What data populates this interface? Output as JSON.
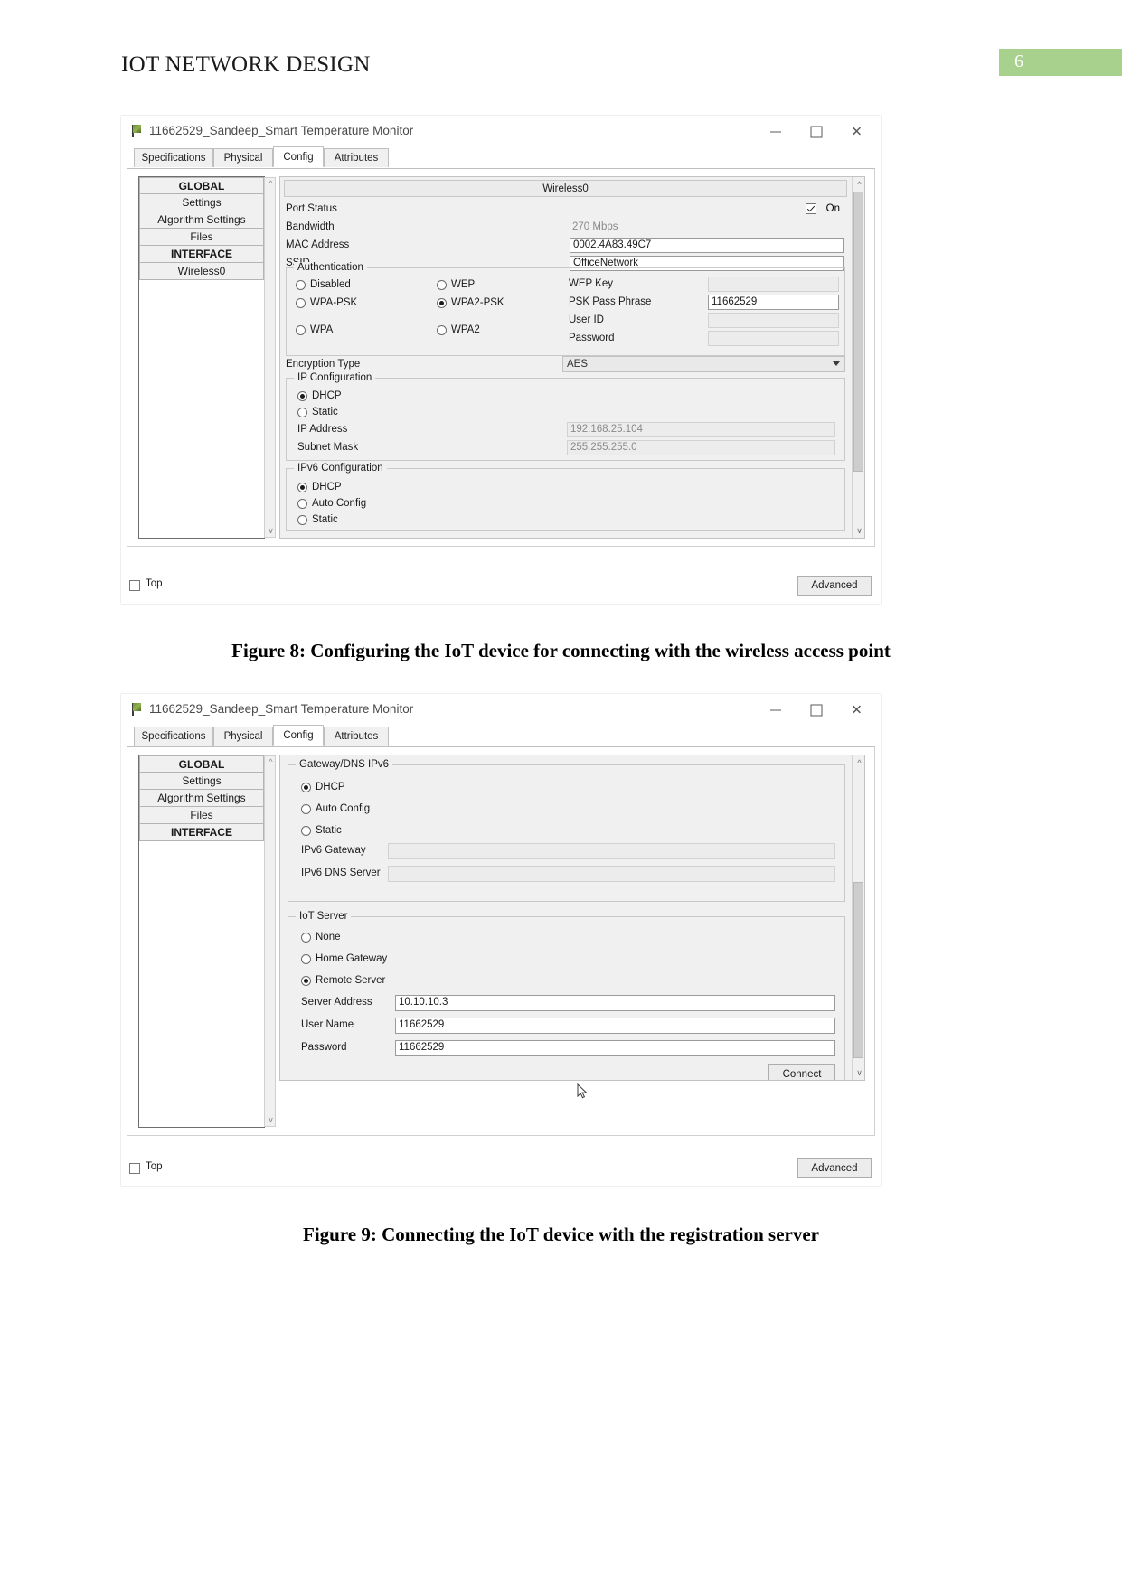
{
  "document": {
    "header_title": "IOT NETWORK DESIGN",
    "page_number": "6",
    "page_badge_color": "#a9d18e",
    "caption_1": "Figure 8: Configuring the IoT device for connecting with the wireless access point",
    "caption_2": "Figure 9: Connecting the IoT device with the registration server"
  },
  "window1": {
    "title": "11662529_Sandeep_Smart Temperature Monitor",
    "icon": "packet-tracer-device-icon",
    "controls": {
      "minimize": "—",
      "maximize": "□",
      "close": "✕"
    },
    "tabs": [
      {
        "label": "Specifications",
        "active": false
      },
      {
        "label": "Physical",
        "active": false
      },
      {
        "label": "Config",
        "active": true
      },
      {
        "label": "Attributes",
        "active": false
      }
    ],
    "sidebar": [
      {
        "label": "GLOBAL",
        "header": true
      },
      {
        "label": "Settings",
        "header": false
      },
      {
        "label": "Algorithm Settings",
        "header": false
      },
      {
        "label": "Files",
        "header": false
      },
      {
        "label": "INTERFACE",
        "header": true
      },
      {
        "label": "Wireless0",
        "header": false
      }
    ],
    "panel_header": "Wireless0",
    "port_status": {
      "label": "Port Status",
      "on_label": "On",
      "checked": true
    },
    "bandwidth": {
      "label": "Bandwidth",
      "value": "270 Mbps"
    },
    "mac_address": {
      "label": "MAC Address",
      "value": "0002.4A83.49C7"
    },
    "ssid": {
      "label": "SSID",
      "value": "OfficeNetwork"
    },
    "authentication": {
      "title": "Authentication",
      "options": [
        {
          "label": "Disabled",
          "selected": false
        },
        {
          "label": "WEP",
          "selected": false
        },
        {
          "label": "WPA-PSK",
          "selected": false
        },
        {
          "label": "WPA2-PSK",
          "selected": true
        },
        {
          "label": "WPA",
          "selected": false
        },
        {
          "label": "WPA2",
          "selected": false
        }
      ],
      "fields": [
        {
          "label": "WEP Key",
          "value": "",
          "disabled": true
        },
        {
          "label": "PSK Pass Phrase",
          "value": "11662529",
          "disabled": false
        },
        {
          "label": "User ID",
          "value": "",
          "disabled": true
        },
        {
          "label": "Password",
          "value": "",
          "disabled": true
        }
      ]
    },
    "encryption": {
      "label": "Encryption Type",
      "value": "AES"
    },
    "ip_configuration": {
      "title": "IP Configuration",
      "options": [
        {
          "label": "DHCP",
          "selected": true
        },
        {
          "label": "Static",
          "selected": false
        }
      ],
      "ip_address": {
        "label": "IP Address",
        "value": "192.168.25.104"
      },
      "subnet_mask": {
        "label": "Subnet Mask",
        "value": "255.255.255.0"
      }
    },
    "ipv6_configuration": {
      "title": "IPv6 Configuration",
      "options": [
        {
          "label": "DHCP",
          "selected": true
        },
        {
          "label": "Auto Config",
          "selected": false
        },
        {
          "label": "Static",
          "selected": false
        }
      ]
    },
    "footer": {
      "top_label": "Top",
      "top_checked": false,
      "advanced_label": "Advanced"
    }
  },
  "window2": {
    "title": "11662529_Sandeep_Smart Temperature Monitor",
    "icon": "packet-tracer-device-icon",
    "controls": {
      "minimize": "—",
      "maximize": "□",
      "close": "✕"
    },
    "tabs": [
      {
        "label": "Specifications",
        "active": false
      },
      {
        "label": "Physical",
        "active": false
      },
      {
        "label": "Config",
        "active": true
      },
      {
        "label": "Attributes",
        "active": false
      }
    ],
    "sidebar": [
      {
        "label": "GLOBAL",
        "header": true
      },
      {
        "label": "Settings",
        "header": false
      },
      {
        "label": "Algorithm Settings",
        "header": false
      },
      {
        "label": "Files",
        "header": false
      },
      {
        "label": "INTERFACE",
        "header": true
      }
    ],
    "gateway_dns": {
      "title": "Gateway/DNS IPv6",
      "options": [
        {
          "label": "DHCP",
          "selected": true
        },
        {
          "label": "Auto Config",
          "selected": false
        },
        {
          "label": "Static",
          "selected": false
        }
      ],
      "ipv6_gateway": {
        "label": "IPv6 Gateway",
        "value": ""
      },
      "ipv6_dns_server": {
        "label": "IPv6 DNS Server",
        "value": ""
      }
    },
    "iot_server": {
      "title": "IoT Server",
      "options": [
        {
          "label": "None",
          "selected": false
        },
        {
          "label": "Home Gateway",
          "selected": false
        },
        {
          "label": "Remote Server",
          "selected": true
        }
      ],
      "server_address": {
        "label": "Server Address",
        "value": "10.10.10.3"
      },
      "user_name": {
        "label": "User Name",
        "value": "11662529"
      },
      "password": {
        "label": "Password",
        "value": "11662529"
      },
      "connect_label": "Connect"
    },
    "footer": {
      "top_label": "Top",
      "top_checked": false,
      "advanced_label": "Advanced"
    }
  }
}
